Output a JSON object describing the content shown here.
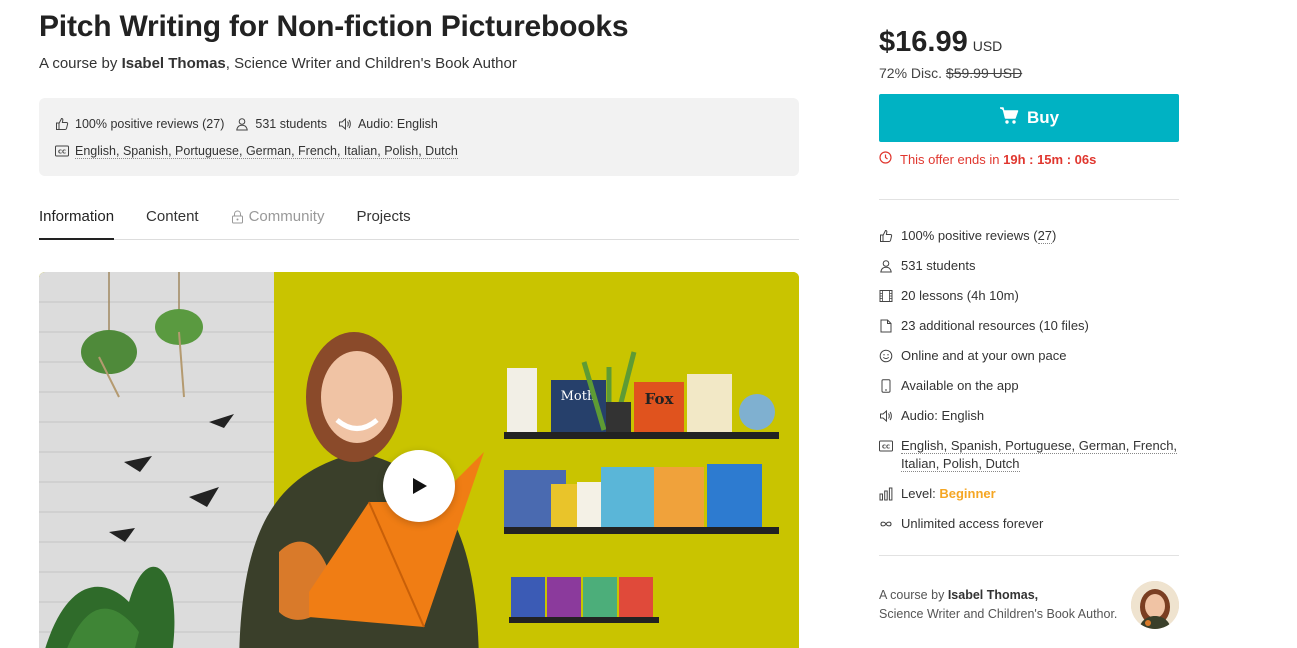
{
  "course": {
    "title": "Pitch Writing for Non-fiction Picturebooks",
    "subtitle_prefix": "A course by",
    "author_name": "Isabel Thomas",
    "author_role": ", Science Writer and Children's Book Author"
  },
  "meta": {
    "reviews": "100% positive reviews (27)",
    "students": "531 students",
    "audio": "Audio: English",
    "subtitles": "English, Spanish, Portuguese, German, French, Italian, Polish, Dutch"
  },
  "tabs": [
    {
      "label": "Information"
    },
    {
      "label": "Content"
    },
    {
      "label": "Community"
    },
    {
      "label": "Projects"
    }
  ],
  "purchase": {
    "price": "$16.99",
    "currency": "USD",
    "discount_label": "72% Disc.",
    "original_price": "$59.99 USD",
    "buy_label": "Buy",
    "offer_prefix": "This offer ends in",
    "offer_time": "19h : 15m : 06s"
  },
  "features": {
    "reviews_prefix": "100% positive reviews (",
    "reviews_count": "27",
    "reviews_suffix": ")",
    "students": "531 students",
    "lessons": "20 lessons (4h 10m)",
    "resources": "23 additional resources (10 files)",
    "pace": "Online and at your own pace",
    "app": "Available on the app",
    "audio": "Audio: English",
    "subtitles_line1": "English, Spanish, Portuguese, German, French,",
    "subtitles_line2": "Italian, Polish, Dutch",
    "level_label": "Level:",
    "level_value": "Beginner",
    "access": "Unlimited access forever"
  },
  "author_card": {
    "line1_prefix": "A course by",
    "name": "Isabel Thomas,",
    "line2": "Science Writer and Children's Book Author."
  },
  "video": {
    "books": [
      "Moth",
      "Fox"
    ]
  },
  "colors": {
    "accent": "#00b2c3",
    "offer_red": "#e0372f",
    "level_orange": "#f5a623",
    "video_wall": "#c8c400"
  }
}
